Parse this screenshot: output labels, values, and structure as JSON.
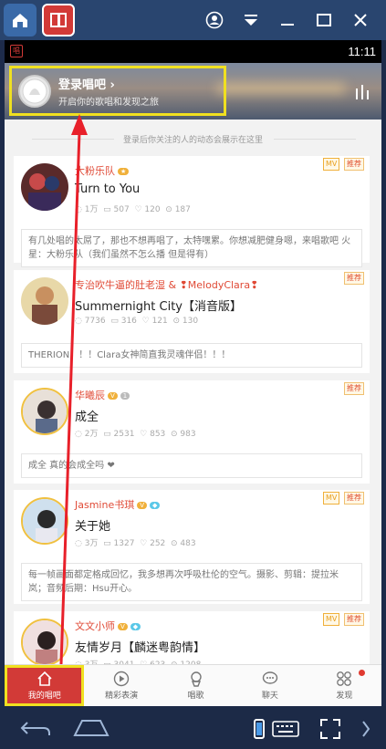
{
  "status_bar": {
    "time": "11:11",
    "notif_icon_label": "唱"
  },
  "header": {
    "login_title": "登录唱吧",
    "login_arrow": "›",
    "login_subtitle": "开启你的歌唱和发现之旅"
  },
  "hint_text": "登录后你关注的人的动态会展示在这里",
  "feed": [
    {
      "name": "大粉乐队",
      "song": "Turn to You",
      "stats": {
        "listens": "1万",
        "comments": "507",
        "gifts": "120",
        "shares": "187"
      },
      "badges": [
        "MV",
        "推荐"
      ],
      "comment": "有几处唱的太屌了，那也不想再唱了，太特嘿累。你想减肥健身嗯，来唱歌吧 火星：大粉乐队（我们虽然不怎么播 但是得有）"
    },
    {
      "name": "专治吹牛逼的肚老湿 & ❢MelodyClara❢",
      "song": "Summernight City【消音版】",
      "stats": {
        "listens": "7736",
        "comments": "316",
        "gifts": "121",
        "shares": "130"
      },
      "badges": [
        "推荐"
      ],
      "comment": "THERION！！！Clara女神简直我灵魂伴侣！！！"
    },
    {
      "name": "华曦辰",
      "song": "成全",
      "stats": {
        "listens": "2万",
        "comments": "2531",
        "gifts": "853",
        "shares": "983"
      },
      "badges": [
        "推荐"
      ],
      "comment": "成全 真的会成全吗 ❤"
    },
    {
      "name": "Jasmine书琪",
      "song": "关于她",
      "stats": {
        "listens": "3万",
        "comments": "1327",
        "gifts": "252",
        "shares": "483"
      },
      "badges": [
        "MV",
        "推荐"
      ],
      "comment": "每一帧画面都定格成回忆，我多想再次呼吸杜伦的空气。摄影、剪辑：提拉米岚；音频后期：Hsu开心。"
    },
    {
      "name": "文文小师",
      "song": "友情岁月【麟迷粤韵情】",
      "stats": {
        "listens": "3万",
        "comments": "3041",
        "gifts": "623",
        "shares": "1208"
      },
      "badges": [
        "MV",
        "推荐"
      ],
      "comment": ""
    }
  ],
  "bottom_nav": [
    {
      "label": "我的唱吧",
      "icon": "home-icon",
      "active": true
    },
    {
      "label": "精彩表演",
      "icon": "play-circle-icon",
      "active": false
    },
    {
      "label": "唱歌",
      "icon": "microphone-icon",
      "active": false
    },
    {
      "label": "聊天",
      "icon": "chat-bubble-icon",
      "active": false
    },
    {
      "label": "发现",
      "icon": "discover-grid-icon",
      "active": false
    }
  ],
  "colors": {
    "accent": "#d23a37",
    "highlight_box": "#f0e020",
    "username": "#e04a36"
  }
}
